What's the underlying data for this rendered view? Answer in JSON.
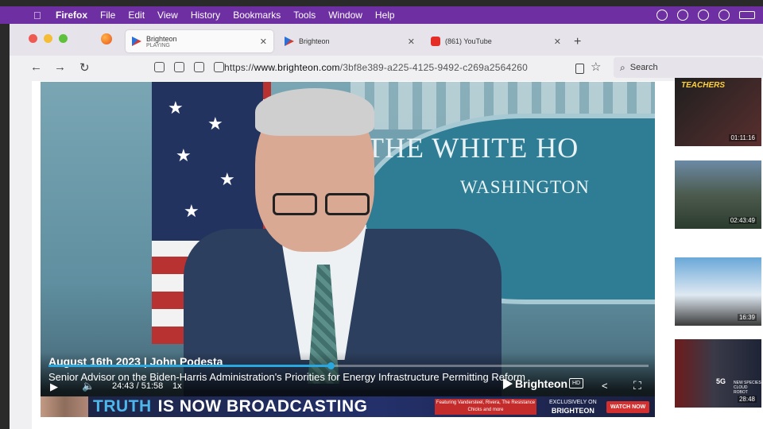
{
  "menubar": {
    "app": "Firefox",
    "items": [
      "File",
      "Edit",
      "View",
      "History",
      "Bookmarks",
      "Tools",
      "Window",
      "Help"
    ]
  },
  "tabs": [
    {
      "title": "Brighteon",
      "subtitle": "PLAYING",
      "icon": "brighteon-logo-icon",
      "active": true
    },
    {
      "title": "Brighteon",
      "icon": "brighteon-logo-icon",
      "active": false
    },
    {
      "title": "(861) YouTube",
      "icon": "youtube-logo-icon",
      "active": false
    }
  ],
  "address": {
    "scheme": "https://",
    "domain": "www.brighteon.com",
    "path": "/3bf8e389-a225-4125-9492-c269a2564260"
  },
  "search": {
    "placeholder": "Search"
  },
  "video": {
    "scene": {
      "line1": "THE WHITE HO",
      "line2": "WASHINGTON"
    },
    "lower_third": {
      "title": "August 16th 2023 | John Podesta",
      "subtitle": "Senior Advisor on the Biden-Harris Administration's Priorities for Energy Infrastructure Permitting Reform"
    },
    "progress": 0.47,
    "time_current": "24:43",
    "time_total": "51:58",
    "speed": "1x",
    "brand": "Brighteon",
    "quality": "HD"
  },
  "banner": {
    "truth": "TRUTH",
    "rest": "IS NOW BROADCASTING",
    "featuring": "Featuring Vandersteel, Rivera, The Resistance Chicks and more",
    "exclusive": "EXCLUSIVELY ON",
    "brand": "BRIGHTEON",
    "cta": "WATCH NOW"
  },
  "sidebar": {
    "thumbs": [
      {
        "caption": "TEACHERS",
        "duration": "01:11:16"
      },
      {
        "caption": "",
        "duration": "02:43:49"
      },
      {
        "caption": "",
        "duration": "16:39"
      },
      {
        "caption": "5G",
        "caption2": "NEW SPECIES CLOUD ROBOT",
        "duration": "28:48"
      }
    ]
  },
  "colors": {
    "menubar": "#6e2fa3",
    "accent": "#29a8e0",
    "banner_cta": "#d32f2f"
  }
}
